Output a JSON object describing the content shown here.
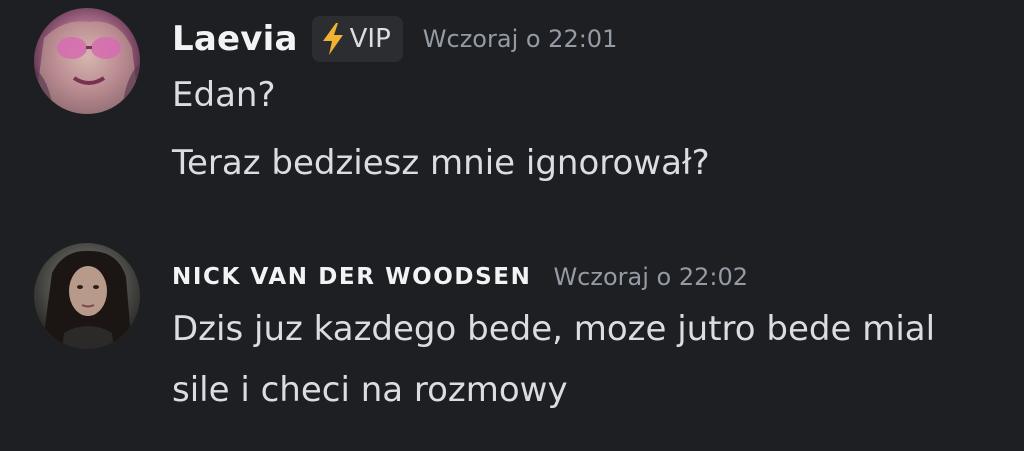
{
  "messages": [
    {
      "author": "Laevia",
      "badge": "VIP",
      "timestamp": "Wczoraj o 22:01",
      "lines": [
        "Edan?",
        "Teraz bedziesz mnie ignorował?"
      ],
      "avatar_icon": "avatar-laevia"
    },
    {
      "author": "NICK VAN DER WOODSEN",
      "timestamp": "Wczoraj o 22:02",
      "lines": [
        "Dzis juz kazdego bede, moze jutro bede mial",
        "sile i checi na rozmowy"
      ],
      "avatar_icon": "avatar-nick"
    }
  ],
  "colors": {
    "background": "#1e1f22",
    "username": "#f2f3f5",
    "text": "#dbdee1",
    "timestamp": "#949ba4",
    "badge_bg": "#2b2d31",
    "bolt": "#f0b232"
  }
}
